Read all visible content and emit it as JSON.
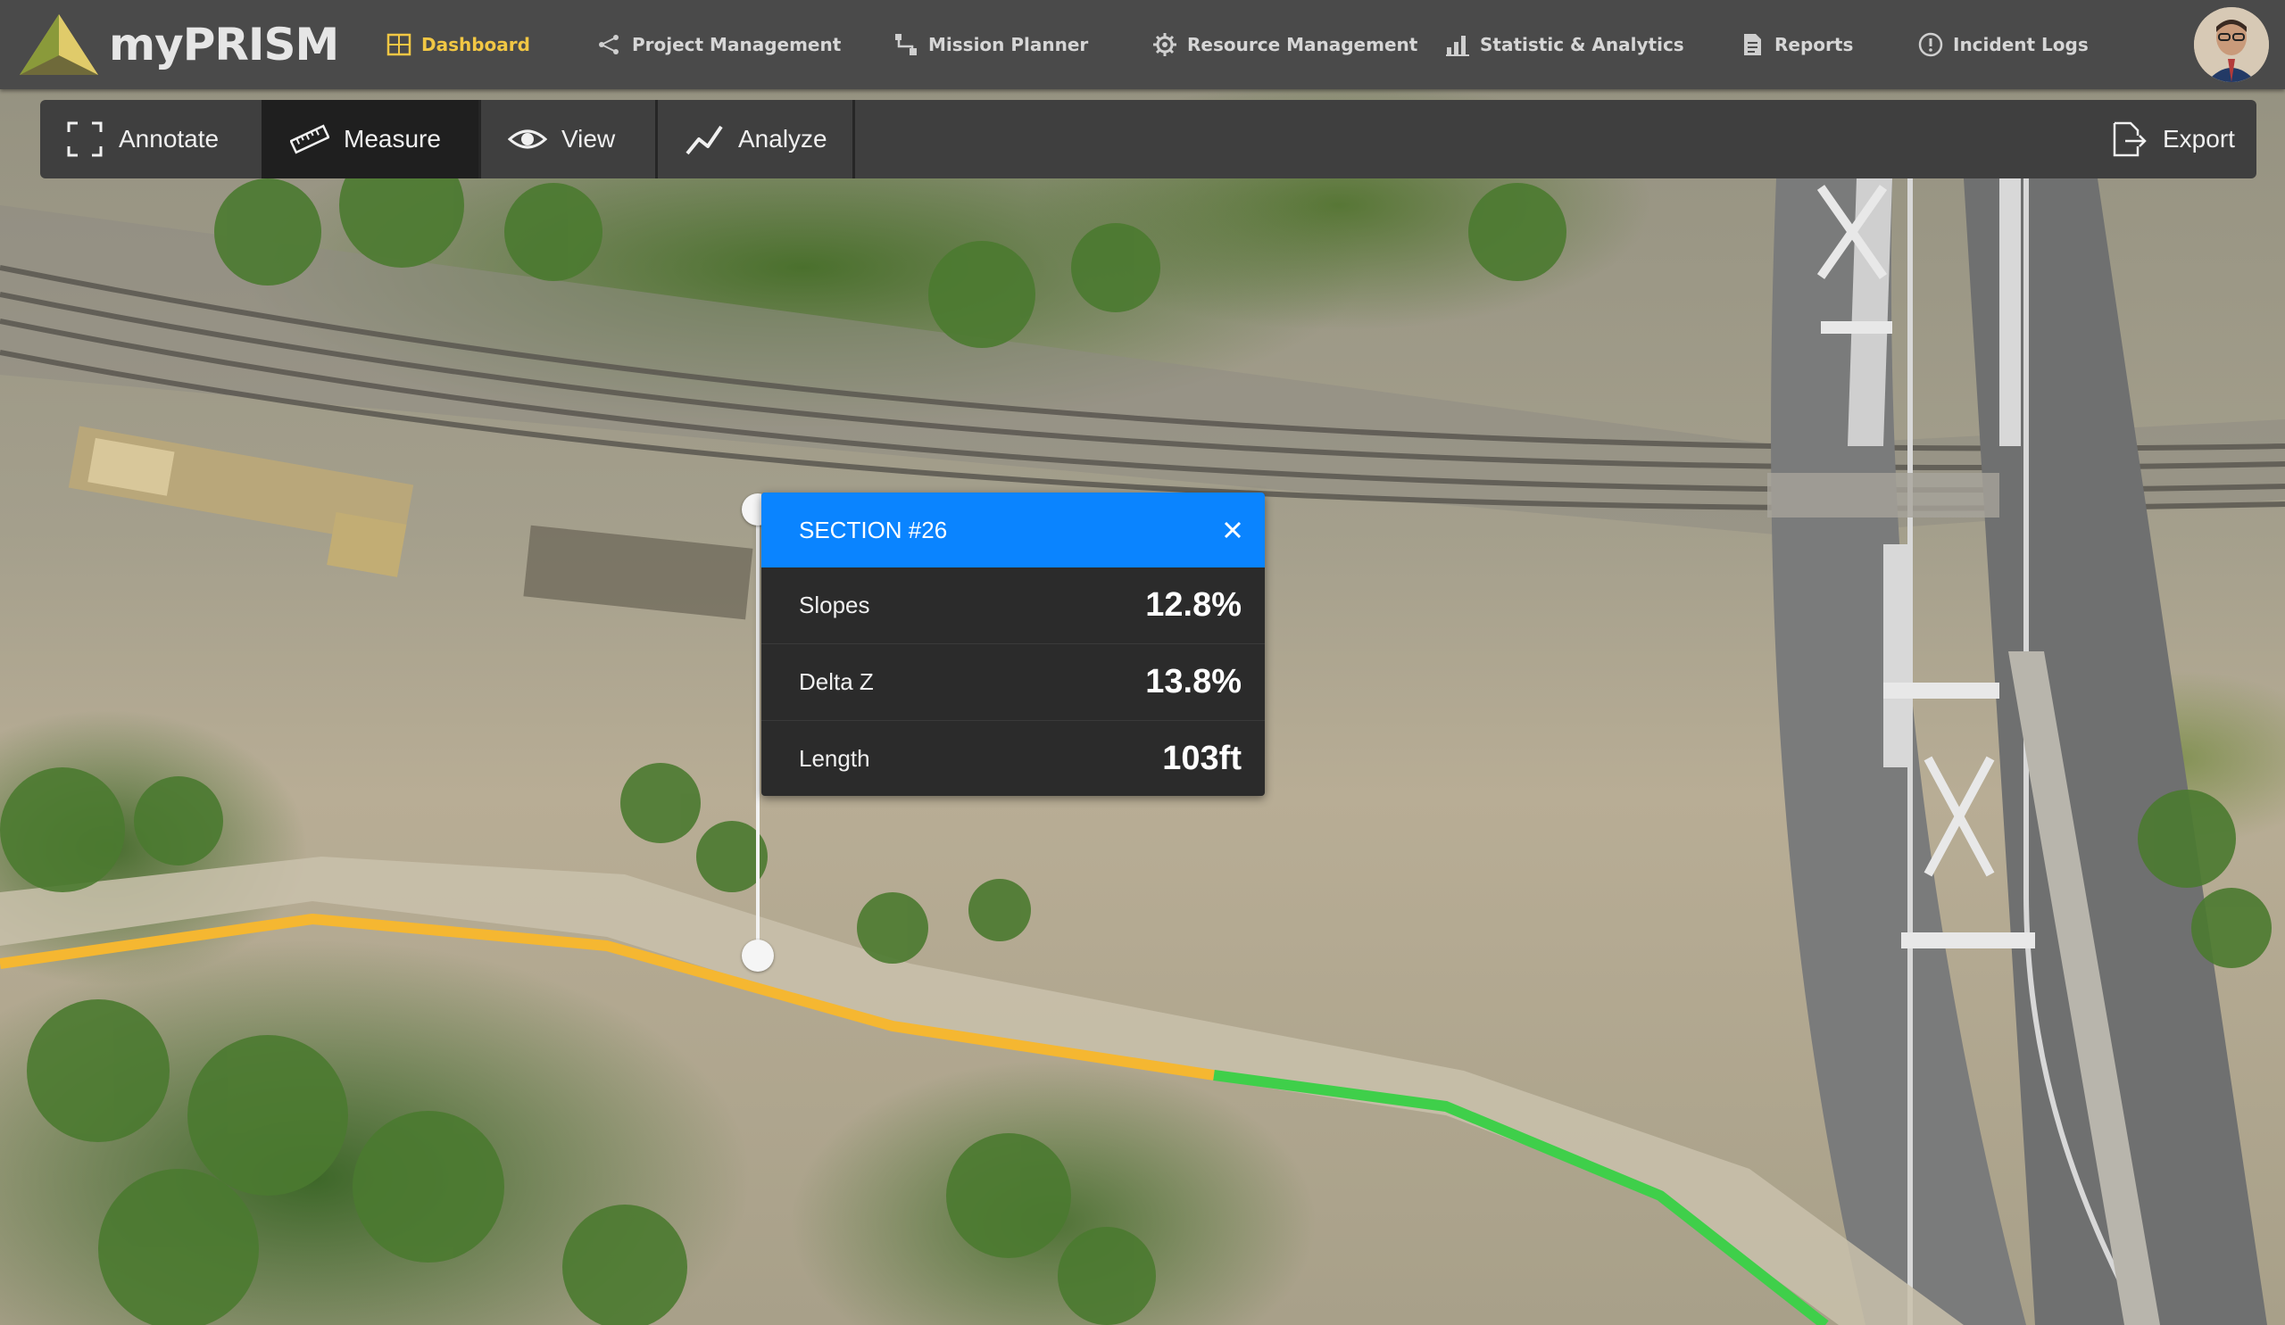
{
  "app": {
    "name": "myPRISM"
  },
  "nav": {
    "items": [
      {
        "label": "Dashboard",
        "icon": "grid-icon",
        "active": true
      },
      {
        "label": "Project Management",
        "icon": "share-nodes-icon",
        "active": false
      },
      {
        "label": "Mission Planner",
        "icon": "route-icon",
        "active": false
      },
      {
        "label": "Resource Management",
        "icon": "gear-icon",
        "active": false
      },
      {
        "label": "Statistic & Analytics",
        "icon": "bar-chart-icon",
        "active": false
      },
      {
        "label": "Reports",
        "icon": "document-icon",
        "active": false
      },
      {
        "label": "Incident Logs",
        "icon": "alert-circle-icon",
        "active": false
      }
    ],
    "active_color": "#f2c744"
  },
  "toolbar": {
    "tools": [
      {
        "label": "Annotate",
        "icon": "frame-corners-icon",
        "active": false
      },
      {
        "label": "Measure",
        "icon": "ruler-icon",
        "active": true
      },
      {
        "label": "View",
        "icon": "eye-icon",
        "active": false
      },
      {
        "label": "Analyze",
        "icon": "trend-line-icon",
        "active": false
      }
    ],
    "export_label": "Export",
    "export_icon": "export-file-icon"
  },
  "section_popup": {
    "title": "SECTION #26",
    "header_color": "#0a84ff",
    "rows": [
      {
        "label": "Slopes",
        "value": "12.8%"
      },
      {
        "label": "Delta Z",
        "value": "13.8%"
      },
      {
        "label": "Length",
        "value": "103ft"
      }
    ]
  },
  "path_colors": {
    "measured_segment": "#f5b731",
    "remaining_segment": "#3fcf4a"
  }
}
